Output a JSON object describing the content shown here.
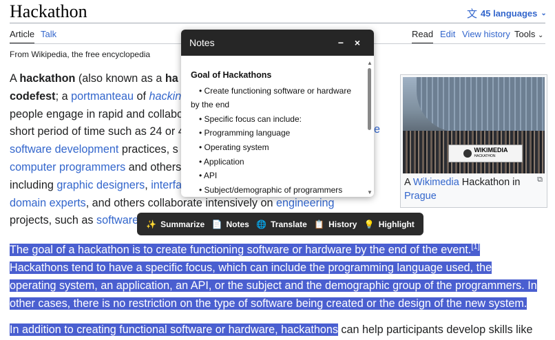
{
  "page": {
    "title": "Hackathon",
    "languages": "45 languages",
    "tabs_left": [
      "Article",
      "Talk"
    ],
    "tabs_right": [
      "Read",
      "Edit",
      "View history",
      "Tools"
    ],
    "tagline": "From Wikipedia, the free encyclopedia"
  },
  "article": {
    "p1": [
      {
        "t": "A "
      },
      {
        "t": "hackathon",
        "b": true
      },
      {
        "t": " (also known as a "
      },
      {
        "t": "ha",
        "b": true
      },
      {
        "t": "\n"
      },
      {
        "t": "codefest",
        "b": true
      },
      {
        "t": "; a "
      },
      {
        "t": "portmanteau",
        "link": true
      },
      {
        "t": " of "
      },
      {
        "t": "hackin",
        "link": true,
        "i": true
      },
      {
        "t": "\n"
      },
      {
        "t": "people engage in rapid and collabo"
      },
      {
        "t": "\n"
      },
      {
        "t": "short period of time such as 24 or 4"
      },
      {
        "t": "\n"
      },
      {
        "t": "software development",
        "link": true
      },
      {
        "t": " practices, s"
      },
      {
        "t": "\n"
      },
      {
        "t": "computer programmers",
        "link": true
      },
      {
        "t": " and others"
      },
      {
        "t": "\n"
      },
      {
        "t": "including "
      },
      {
        "t": "graphic designers",
        "link": true
      },
      {
        "t": ", "
      },
      {
        "t": "interfa",
        "link": true
      },
      {
        "t": "\n"
      },
      {
        "t": "domain experts",
        "link": true
      },
      {
        "t": ", and others collaborate intensively on "
      },
      {
        "t": "engineering",
        "link": true
      },
      {
        "t": "\n"
      },
      {
        "t": "projects, such as "
      },
      {
        "t": "software",
        "link": true
      }
    ],
    "p1_right_fragment": "e",
    "p2_lines": [
      "The goal of a hackathon is to create functioning software or hardware by the end of the event.",
      "Hackathons tend to have a specific focus, which can include the programming language used, the",
      "operating system, an application, an API, or the subject and the demographic group of the programmers. In",
      "other cases, there is no restriction on the type of software being created or the design of the new system."
    ],
    "p2_ref": "[1]",
    "p3_highlighted": "In addition to creating functional software or hardware, hackathons",
    "p3_rest": " can help participants develop skills like"
  },
  "figure": {
    "banner_text": "WIKIMEDIA",
    "banner_sub": "HACKATHON",
    "caption_pre": "A ",
    "caption_link1": "Wikimedia",
    "caption_mid": " Hackathon in ",
    "caption_link2": "Prague"
  },
  "notes": {
    "title": "Notes",
    "minimize": "−",
    "close": "×",
    "heading": "Goal of Hackathons",
    "items": [
      "Create functioning software or hardware",
      "by the end",
      "Specific focus can include:",
      "Programming language",
      "Operating system",
      "Application",
      "API",
      "Subject/demographic of programmers"
    ]
  },
  "toolbar": {
    "items": [
      {
        "label": "Summarize",
        "icon": "✨",
        "icon_name": "sparkle-icon"
      },
      {
        "label": "Notes",
        "icon": "📄",
        "icon_name": "notes-icon"
      },
      {
        "label": "Translate",
        "icon": "🌐",
        "icon_name": "globe-icon"
      },
      {
        "label": "History",
        "icon": "📋",
        "icon_name": "history-icon"
      },
      {
        "label": "Highlight",
        "icon": "💡",
        "icon_name": "bulb-icon"
      }
    ]
  },
  "colors": {
    "link": "#3366cc",
    "highlight": "#4a5fd0",
    "toolbar": "#2b2b2b",
    "notes_header": "#262626"
  }
}
